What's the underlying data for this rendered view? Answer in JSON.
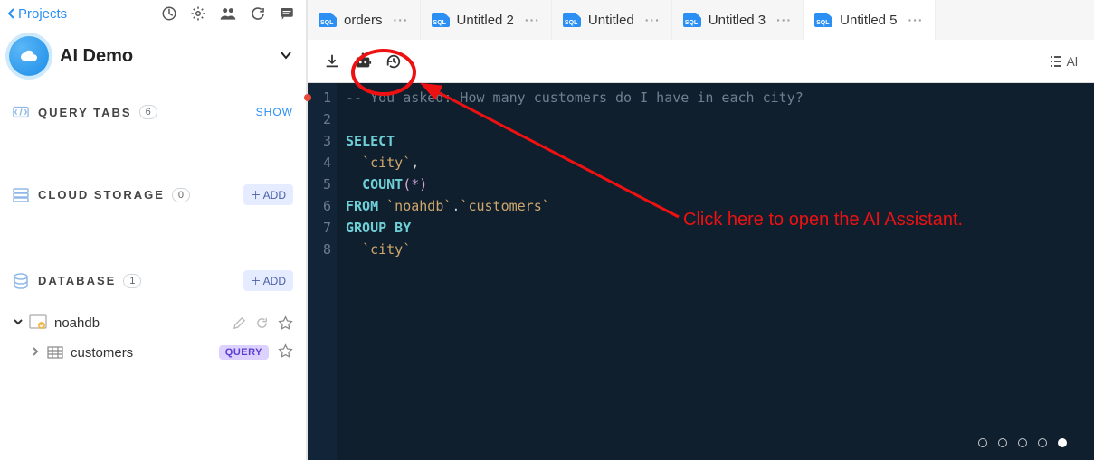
{
  "sidebar": {
    "back_label": "Projects",
    "project_name": "AI Demo",
    "query_tabs": {
      "label": "QUERY TABS",
      "count": "6",
      "action": "SHOW"
    },
    "cloud_storage": {
      "label": "CLOUD STORAGE",
      "count": "0",
      "action": "ADD"
    },
    "database": {
      "label": "DATABASE",
      "count": "1",
      "action": "ADD"
    },
    "db": {
      "name": "noahdb"
    },
    "table": {
      "name": "customers",
      "query_badge": "QUERY"
    }
  },
  "tabs": [
    {
      "label": "orders",
      "active": false
    },
    {
      "label": "Untitled 2",
      "active": false
    },
    {
      "label": "Untitled",
      "active": false
    },
    {
      "label": "Untitled 3",
      "active": false
    },
    {
      "label": "Untitled 5",
      "active": true
    }
  ],
  "toolbar": {
    "right_label": "Al"
  },
  "editor": {
    "lines": [
      {
        "n": 1,
        "html": "<span class='c-comment'>-- You asked: How many customers do I have in each city?</span>"
      },
      {
        "n": 2,
        "html": ""
      },
      {
        "n": 3,
        "html": "<span class='c-kw'>SELECT</span>"
      },
      {
        "n": 4,
        "html": "  <span class='c-id'>`city`</span><span class='c-punct'>,</span>"
      },
      {
        "n": 5,
        "html": "  <span class='c-kw'>COUNT</span><span class='c-paren'>(</span><span class='c-star'>*</span><span class='c-paren'>)</span>"
      },
      {
        "n": 6,
        "html": "<span class='c-kw'>FROM</span> <span class='c-id'>`noahdb`</span><span class='c-punct'>.</span><span class='c-id'>`customers`</span>"
      },
      {
        "n": 7,
        "html": "<span class='c-kw'>GROUP BY</span>"
      },
      {
        "n": 8,
        "html": "  <span class='c-id'>`city`</span>"
      }
    ]
  },
  "pager": {
    "total": 5,
    "active": 4
  },
  "annotation": {
    "text": "Click here to open the AI Assistant."
  },
  "icons": {
    "sql": "SQL"
  }
}
